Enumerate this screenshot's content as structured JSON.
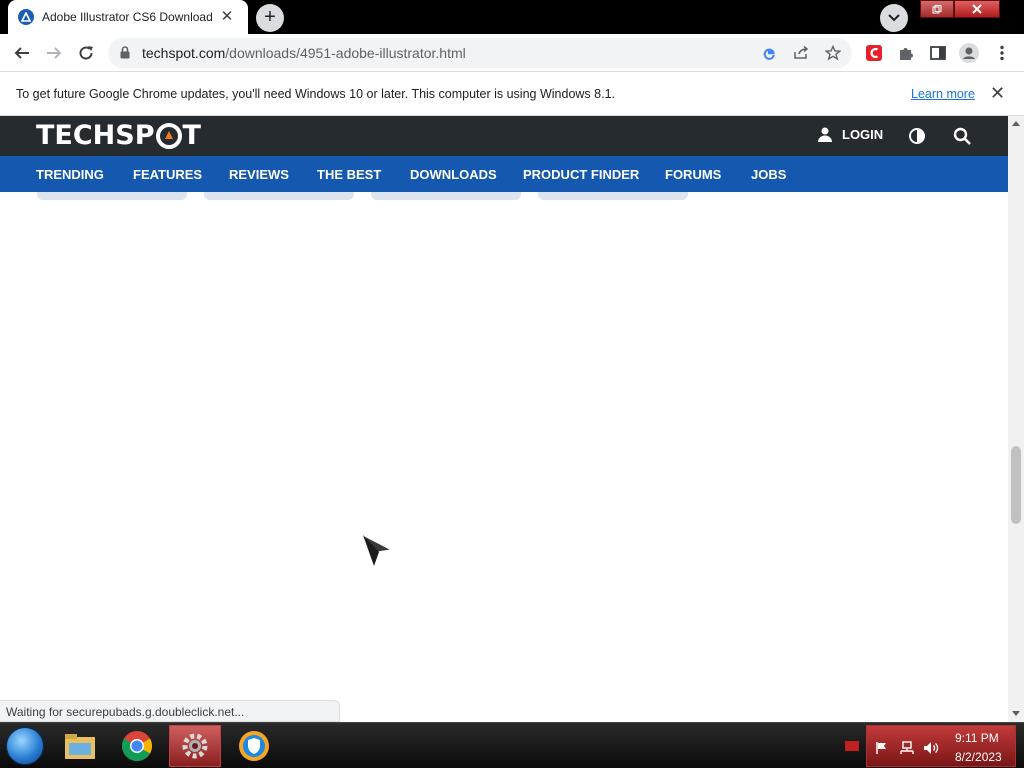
{
  "browser": {
    "tab": {
      "title": "Adobe Illustrator CS6 Download",
      "close": "✕"
    },
    "new_tab": "+",
    "url": {
      "host": "techspot.com",
      "path": "/downloads/4951-adobe-illustrator.html"
    },
    "infobar": {
      "message": "To get future Google Chrome updates, you'll need Windows 10 or later. This computer is using Windows 8.1.",
      "link": "Learn more",
      "close": "✕"
    },
    "status_text": "Waiting for securepubads.g.doubleclick.net..."
  },
  "site": {
    "logo_left": "TECHSP",
    "logo_right": "T",
    "login": "LOGIN",
    "nav": [
      "TRENDING",
      "FEATURES",
      "REVIEWS",
      "THE BEST",
      "DOWNLOADS",
      "PRODUCT FINDER",
      "FORUMS",
      "JOBS"
    ],
    "accent_color": "#1558b0",
    "header_color": "#262b30",
    "logo_accent": "#f07c1c"
  },
  "taskbar": {
    "apps": [
      "internet-explorer-icon",
      "file-explorer-icon",
      "chrome-icon",
      "settings-gear-icon",
      "vpn-shield-icon"
    ],
    "clock": {
      "time": "9:11 PM",
      "date": "8/2/2023"
    }
  }
}
